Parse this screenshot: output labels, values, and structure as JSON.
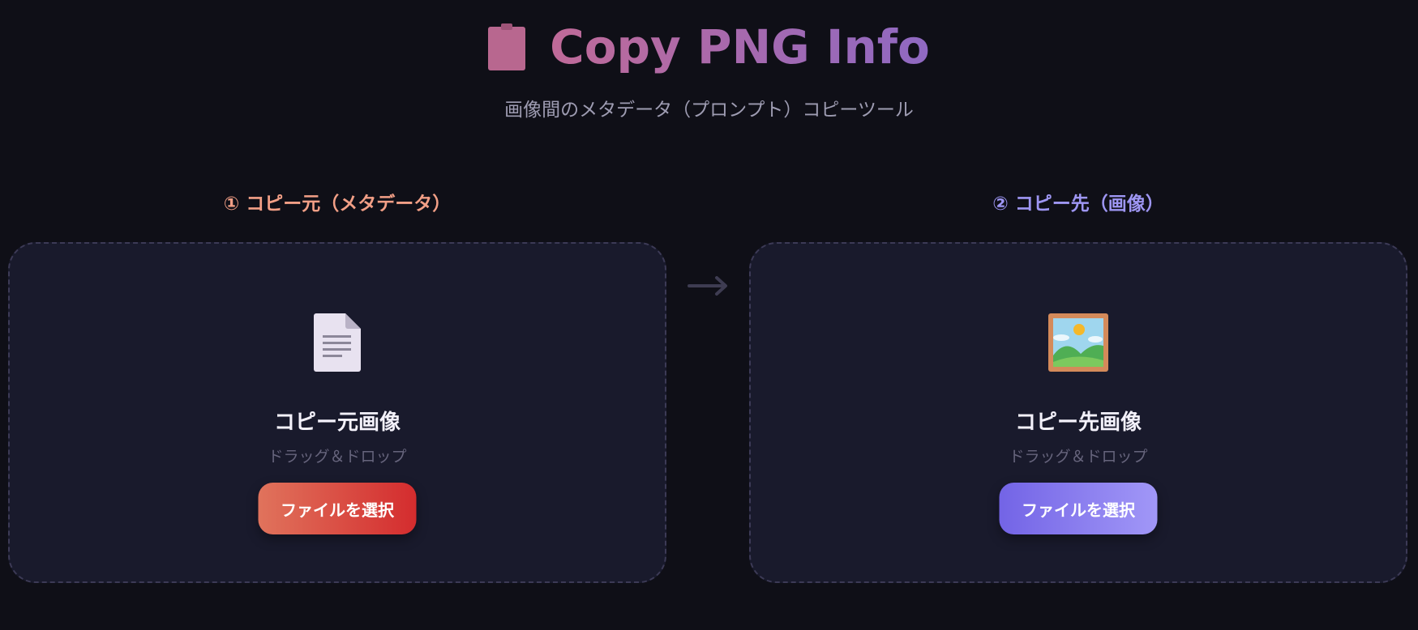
{
  "header": {
    "icon": "clipboard-icon",
    "title": "Copy PNG Info",
    "subtitle": "画像間のメタデータ（プロンプト）コピーツール"
  },
  "source": {
    "label": "① コピー元（メタデータ）",
    "icon": "document-icon",
    "title": "コピー元画像",
    "hint": "ドラッグ＆ドロップ",
    "button_label": "ファイルを選択",
    "accent": "#f29f86"
  },
  "arrow": {
    "icon": "right-arrow-icon",
    "glyph": "→"
  },
  "target": {
    "label": "② コピー先（画像）",
    "icon": "framed-picture-icon",
    "title": "コピー先画像",
    "hint": "ドラッグ＆ドロップ",
    "button_label": "ファイルを選択",
    "accent": "#9e96f3"
  },
  "colors": {
    "background": "#0f0f17",
    "panel": "#191a2c",
    "title_gradient_start": "#c06a98",
    "title_gradient_end": "#8f69c2",
    "source_button": "#d42c2e",
    "target_button": "#7364e6"
  }
}
